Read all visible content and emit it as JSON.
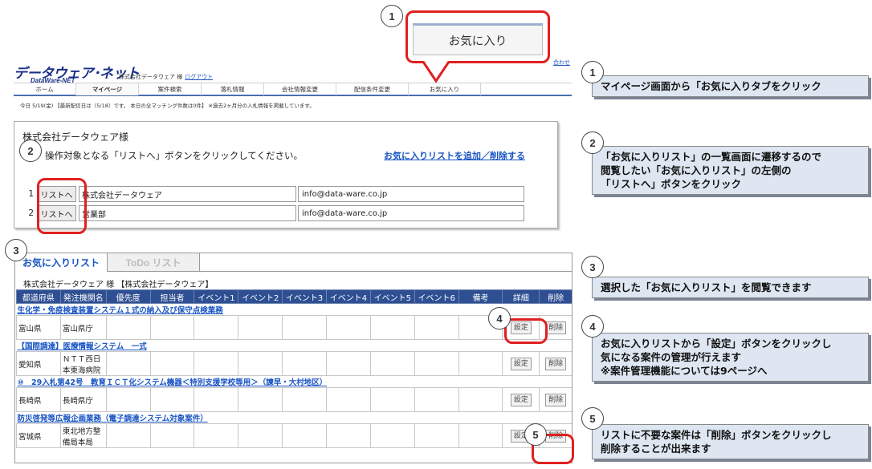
{
  "step1": {
    "fav_tab_big": "お気に入り",
    "logo_main": "データウェア･ネット",
    "logo_sub": "DataWare-NET",
    "company": "株式会社データウェア 様",
    "logout": "ログアウト",
    "contact": "合わせ",
    "nav": [
      "ホーム",
      "マイページ",
      "案件検索",
      "落札情報",
      "会社情報変更",
      "配信条件変更",
      "お気に入り"
    ],
    "info_line": "今日 5/19(金)  【最新配信日は（5/18）です。 本日の全マッチング件数は0件】 ※過去2ヶ月分の入札情報を掲載しています。"
  },
  "step2": {
    "company": "株式会社データウェア様",
    "instruction": "操作対象となる「リストへ」ボタンをクリックしてください。",
    "edit_link": "お気に入りリストを追加／削除する",
    "button_label": "リストへ",
    "lists": [
      {
        "num": "1",
        "name": "株式会社データウェア",
        "email": "info@data-ware.co.jp"
      },
      {
        "num": "2",
        "name": "営業部",
        "email": "info@data-ware.co.jp"
      }
    ]
  },
  "step3": {
    "tabs": [
      "お気に入りリスト",
      "ToDo リスト"
    ],
    "company": "株式会社データウェア 様 【株式会社データウェア】",
    "headers": [
      "都道府県",
      "発注機関名",
      "優先度",
      "担当者",
      "イベント1",
      "イベント2",
      "イベント3",
      "イベント4",
      "イベント5",
      "イベント6",
      "備考",
      "詳細",
      "削除"
    ],
    "set_label": "設定",
    "delete_label": "削除",
    "cases": [
      {
        "title": "生化学・免疫検査装置システム１式の納入及び保守点検業務",
        "pref": "富山県",
        "org": "富山県庁"
      },
      {
        "title": "【国際調達】医療情報システム　一式",
        "pref": "愛知県",
        "org": "ＮＴＴ西日本東海病院"
      },
      {
        "title": "⑩　29入札第42号　教育ＩＣＴ化システム機器＜特別支援学校等用＞（諫早・大村地区）",
        "pref": "長崎県",
        "org": "長崎県庁"
      },
      {
        "title": "防災啓発等広報企画業務（電子調達システム対象案件）",
        "pref": "宮城県",
        "org": "東北地方整備局本局"
      }
    ]
  },
  "circles": [
    "1",
    "2",
    "3",
    "4",
    "5"
  ],
  "callouts": {
    "c1": [
      "マイページ画面から「お気に入りタブをクリック"
    ],
    "c2": [
      "「お気に入りリスト」の一覧画面に遷移するので",
      "閲覧したい「お気に入りリスト」の左側の",
      "「リストへ」ボタンをクリック"
    ],
    "c3": [
      "選択した「お気に入りリスト」を閲覧できます"
    ],
    "c4": [
      "お気に入りリストから「設定」ボタンをクリックし",
      "気になる案件の管理が行えます",
      "※案件管理機能については9ページへ"
    ],
    "c5": [
      "リストに不要な案件は「削除」ボタンをクリックし",
      "削除することが出来ます"
    ]
  }
}
